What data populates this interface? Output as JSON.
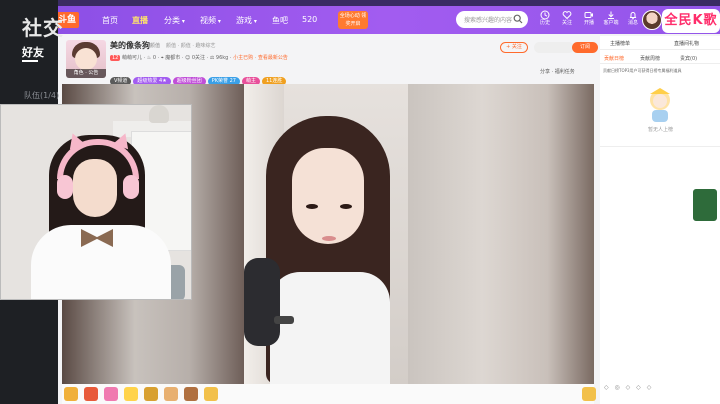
{
  "overlay": {
    "title": "社交",
    "tab": "好友",
    "team_label": "队伍(1/4)"
  },
  "nav": {
    "logo": "斗鱼",
    "items": [
      "首页",
      "直播",
      "分类",
      "视频",
      "游戏",
      "鱼吧",
      "520"
    ],
    "active_index": 1,
    "promo": "全场心动 领奖开启",
    "search_placeholder": "搜索感兴趣的内容",
    "tools": [
      "历史",
      "关注",
      "开播",
      "客户端",
      "消息"
    ],
    "brand": "全民K歌",
    "accent": "#9a55ec"
  },
  "streamer": {
    "name": "美的像条狗",
    "sub": "颜值",
    "sub2": "颜值 · 颜值 · 趣味综艺",
    "avatar_tag": "角色 · 公告",
    "level": "12",
    "meta_name": "萌萌可儿",
    "meta_likes": "0",
    "meta_city": "魔都市",
    "meta_follow": "0关注",
    "meta_fans": "96kg",
    "notice": "小主已购 · 查看最新公告",
    "badges": [
      {
        "label": "V频道",
        "color": "#5a5a5a"
      },
      {
        "label": "超级热爱 4★",
        "color": "#a25cf0"
      },
      {
        "label": "超级粉丝团",
        "color": "#c04fd8"
      },
      {
        "label": "PK荣誉 27",
        "color": "#3aa0e8"
      },
      {
        "label": "萌主",
        "color": "#e84f9a"
      },
      {
        "label": "11连胜",
        "color": "#f0a020"
      }
    ],
    "follow_label": "+ 关注",
    "sub_label": "订阅",
    "links": "分享  · 福利任务"
  },
  "chat": {
    "header_left": "主播榜单",
    "header_right": "直播间礼物",
    "tabs": [
      "贡献日榜",
      "贡献周榜",
      "贵宾(0)"
    ],
    "active_tab": 0,
    "note": "贡献日榜TOP3用户可获得日榜专属福利道具",
    "empty": "暂无人上榜",
    "footer": "◇ ◎ ◇ ◇ ◇"
  }
}
